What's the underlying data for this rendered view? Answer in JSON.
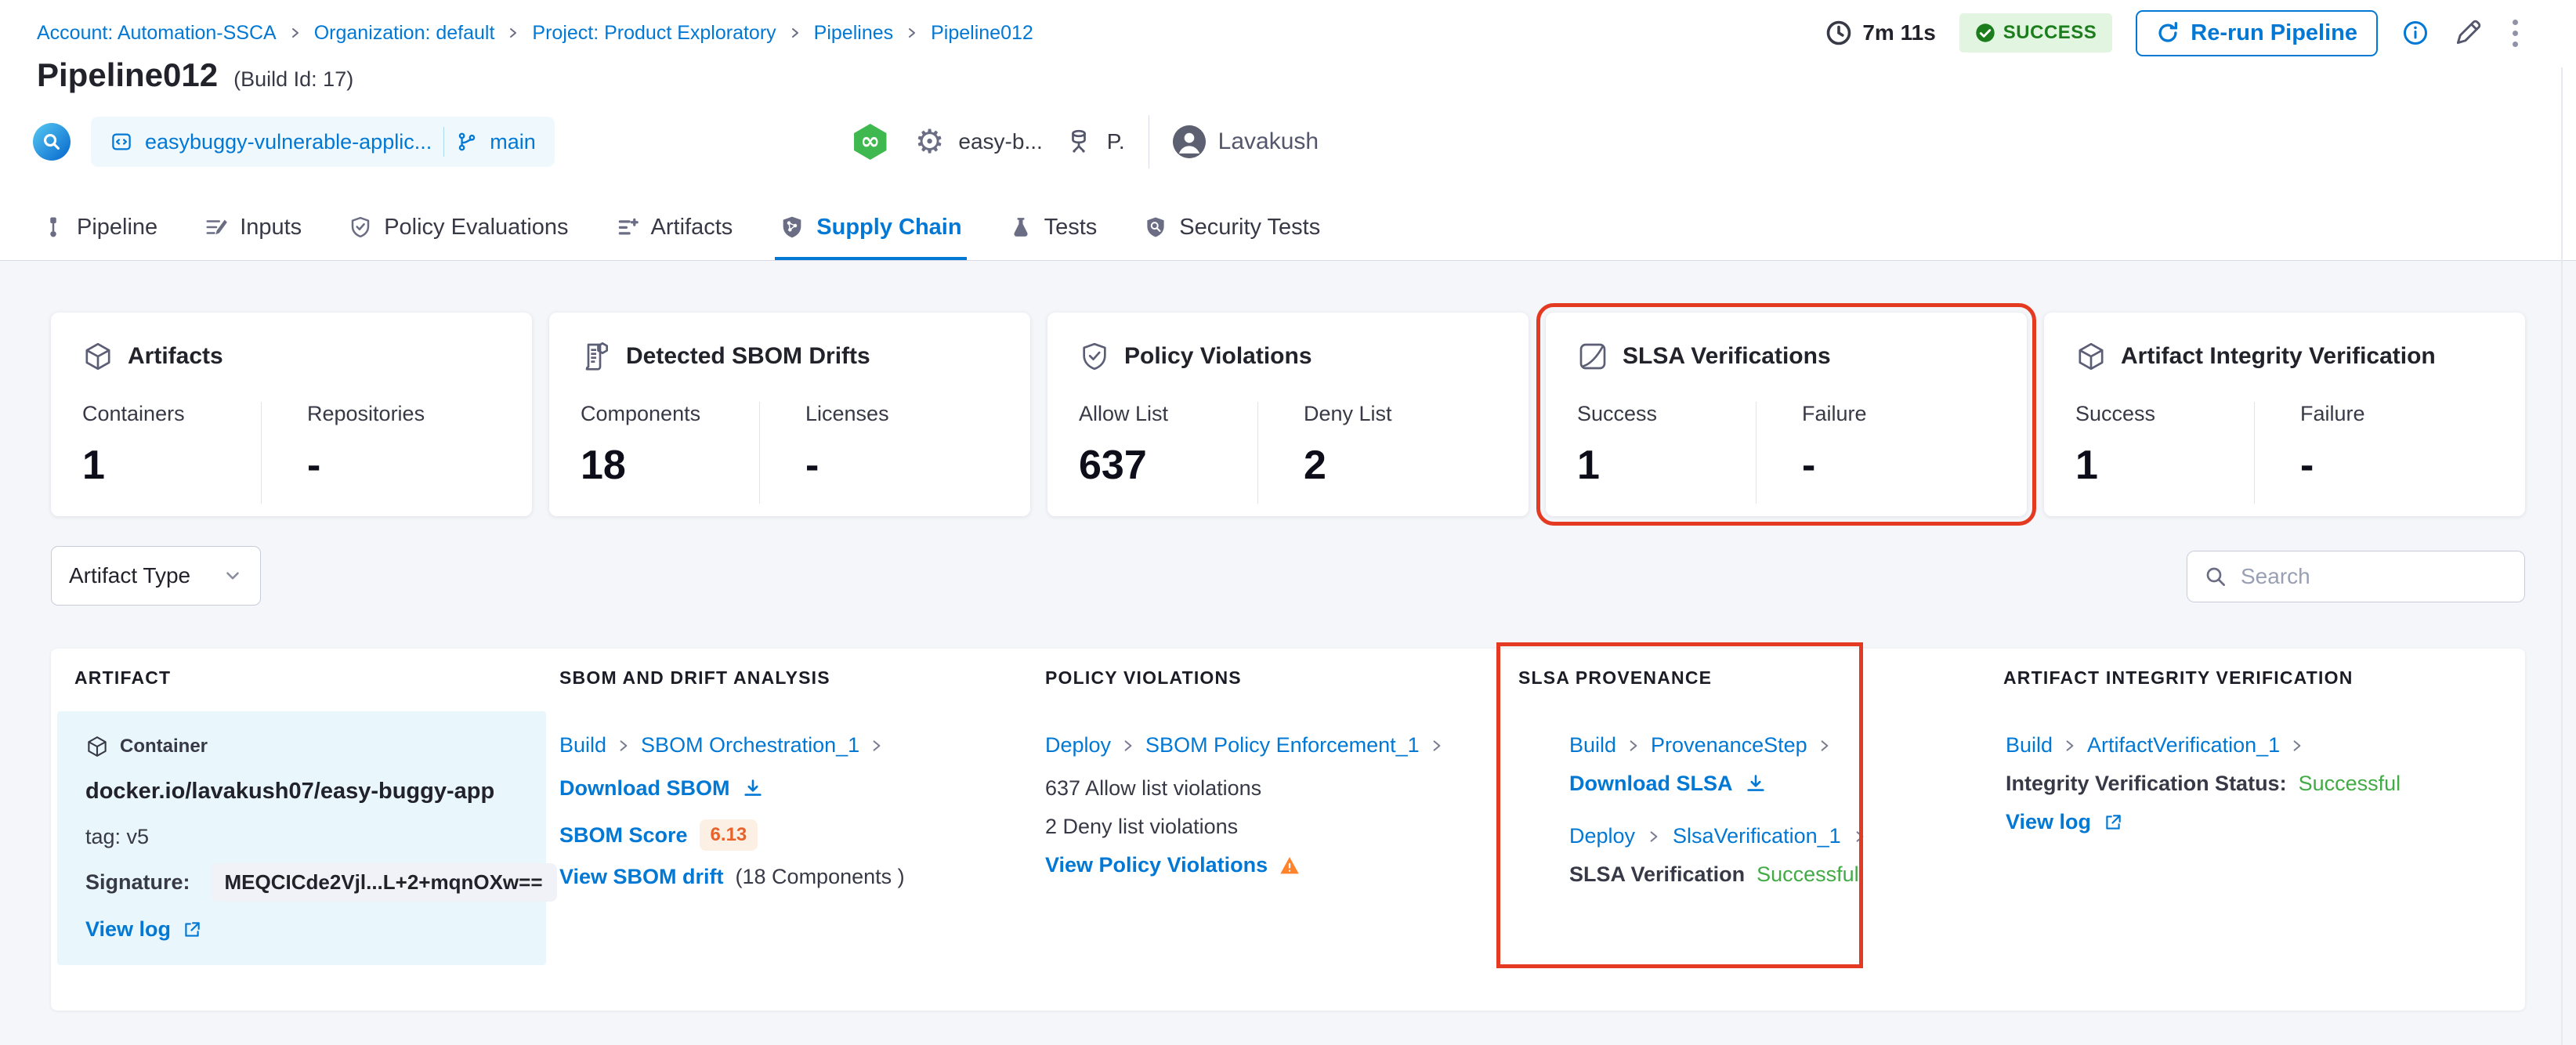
{
  "colors": {
    "accent_blue": "#0278d5",
    "success_green": "#42ab45",
    "badge_green_bg": "#e2f5e1",
    "badge_green_text": "#1b7d1b",
    "highlight_red": "#e53a22",
    "warning_orange": "#ff832b",
    "score_orange": "#e8632a",
    "artifact_cell_bg": "#e9f6fc",
    "page_bg": "#f4f6fa"
  },
  "breadcrumb": {
    "items": [
      {
        "label": "Account: Automation-SSCA"
      },
      {
        "label": "Organization: default"
      },
      {
        "label": "Project: Product Exploratory"
      },
      {
        "label": "Pipelines"
      },
      {
        "label": "Pipeline012"
      }
    ]
  },
  "top_actions": {
    "duration": "7m 11s",
    "status": "SUCCESS",
    "rerun": "Re-run Pipeline"
  },
  "header": {
    "title": "Pipeline012",
    "build_id": "(Build Id: 17)",
    "repo_name": "easybuggy-vulnerable-applic...",
    "branch": "main",
    "service": "easy-b...",
    "env": "P.",
    "user": "Lavakush"
  },
  "tabs": [
    {
      "label": "Pipeline"
    },
    {
      "label": "Inputs"
    },
    {
      "label": "Policy Evaluations"
    },
    {
      "label": "Artifacts"
    },
    {
      "label": "Supply Chain"
    },
    {
      "label": "Tests"
    },
    {
      "label": "Security Tests"
    }
  ],
  "summary_cards": [
    {
      "title": "Artifacts",
      "stats": [
        {
          "label": "Containers",
          "value": "1"
        },
        {
          "label": "Repositories",
          "value": "-"
        }
      ]
    },
    {
      "title": "Detected SBOM Drifts",
      "stats": [
        {
          "label": "Components",
          "value": "18"
        },
        {
          "label": "Licenses",
          "value": "-"
        }
      ]
    },
    {
      "title": "Policy Violations",
      "stats": [
        {
          "label": "Allow List",
          "value": "637"
        },
        {
          "label": "Deny List",
          "value": "2"
        }
      ]
    },
    {
      "title": "SLSA Verifications",
      "stats": [
        {
          "label": "Success",
          "value": "1"
        },
        {
          "label": "Failure",
          "value": "-"
        }
      ]
    },
    {
      "title": "Artifact Integrity Verification",
      "stats": [
        {
          "label": "Success",
          "value": "1"
        },
        {
          "label": "Failure",
          "value": "-"
        }
      ]
    }
  ],
  "filters": {
    "artifact_type": "Artifact Type",
    "search_placeholder": "Search"
  },
  "table": {
    "headers": [
      "ARTIFACT",
      "SBOM AND DRIFT ANALYSIS",
      "POLICY VIOLATIONS",
      "SLSA PROVENANCE",
      "ARTIFACT INTEGRITY VERIFICATION"
    ],
    "row": {
      "artifact": {
        "type": "Container",
        "image": "docker.io/lavakush07/easy-buggy-app",
        "tag": "tag: v5",
        "signature_label": "Signature:",
        "signature": "MEQCICde2Vjl...L+2+mqnOXw==",
        "view_log": "View log"
      },
      "sbom": {
        "stage": "Build",
        "step": "SBOM Orchestration_1",
        "download": "Download SBOM",
        "score_label": "SBOM Score",
        "score": "6.13",
        "drift": "View SBOM drift",
        "drift_count": "(18 Components )"
      },
      "policy": {
        "stage": "Deploy",
        "step": "SBOM Policy Enforcement_1",
        "allow": "637 Allow list violations",
        "deny": "2 Deny list violations",
        "view": "View Policy Violations"
      },
      "slsa": {
        "stage1": "Build",
        "step1": "ProvenanceStep",
        "download": "Download SLSA",
        "stage2": "Deploy",
        "step2": "SlsaVerification_1",
        "status_label": "SLSA Verification",
        "status": "Successful"
      },
      "integrity": {
        "stage": "Build",
        "step": "ArtifactVerification_1",
        "status_label": "Integrity Verification Status:",
        "status": "Successful",
        "view_log": "View log"
      }
    }
  }
}
